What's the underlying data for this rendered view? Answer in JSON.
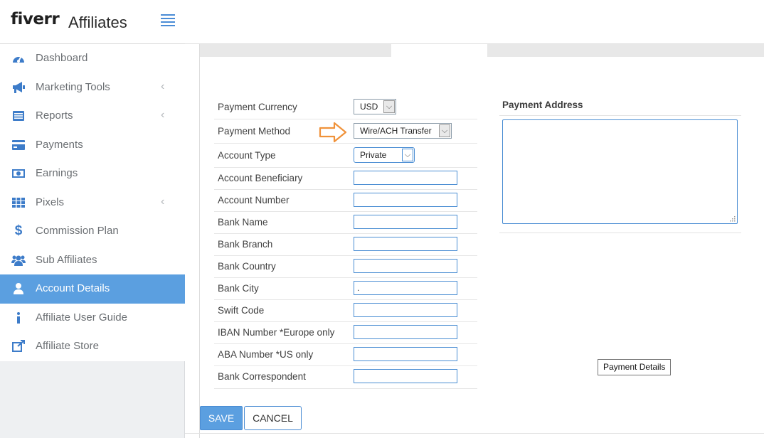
{
  "brand": {
    "logo": "fiverr",
    "product": "Affiliates"
  },
  "nav": {
    "items": [
      {
        "label": "Dashboard",
        "icon": "dashboard-icon"
      },
      {
        "label": "Marketing Tools",
        "icon": "megaphone-icon",
        "has_submenu": true
      },
      {
        "label": "Reports",
        "icon": "reports-icon",
        "has_submenu": true
      },
      {
        "label": "Payments",
        "icon": "credit-card-icon"
      },
      {
        "label": "Earnings",
        "icon": "money-icon"
      },
      {
        "label": "Pixels",
        "icon": "grid-icon",
        "has_submenu": true
      },
      {
        "label": "Commission Plan",
        "icon": "dollar-icon"
      },
      {
        "label": "Sub Affiliates",
        "icon": "users-icon"
      },
      {
        "label": "Account Details",
        "icon": "user-icon",
        "active": true
      },
      {
        "label": "Affiliate User Guide",
        "icon": "info-icon"
      },
      {
        "label": "Affiliate Store",
        "icon": "external-link-icon"
      }
    ],
    "chevron": "‹",
    "accent": "#5b9fe0"
  },
  "form": {
    "currency": {
      "label": "Payment Currency",
      "value": "USD"
    },
    "method": {
      "label": "Payment Method",
      "value": "Wire/ACH Transfer"
    },
    "account_type": {
      "label": "Account Type",
      "value": "Private"
    },
    "beneficiary": {
      "label": "Account Beneficiary",
      "value": ""
    },
    "account_number": {
      "label": "Account Number",
      "value": ""
    },
    "bank_name": {
      "label": "Bank Name",
      "value": ""
    },
    "bank_branch": {
      "label": "Bank Branch",
      "value": ""
    },
    "bank_country": {
      "label": "Bank Country",
      "value": ""
    },
    "bank_city": {
      "label": "Bank City",
      "value": "."
    },
    "swift": {
      "label": "Swift Code",
      "value": ""
    },
    "iban": {
      "label": "IBAN Number *Europe only",
      "value": ""
    },
    "aba": {
      "label": "ABA Number *US only",
      "value": ""
    },
    "correspondent": {
      "label": "Bank Correspondent",
      "value": ""
    },
    "dropdown_glyph": "⌵"
  },
  "address": {
    "label": "Payment Address",
    "value": ""
  },
  "tooltip": {
    "text": "Payment Details"
  },
  "actions": {
    "save": "SAVE",
    "cancel": "CANCEL"
  },
  "annotation": {
    "arrow_color": "#f0923a"
  }
}
